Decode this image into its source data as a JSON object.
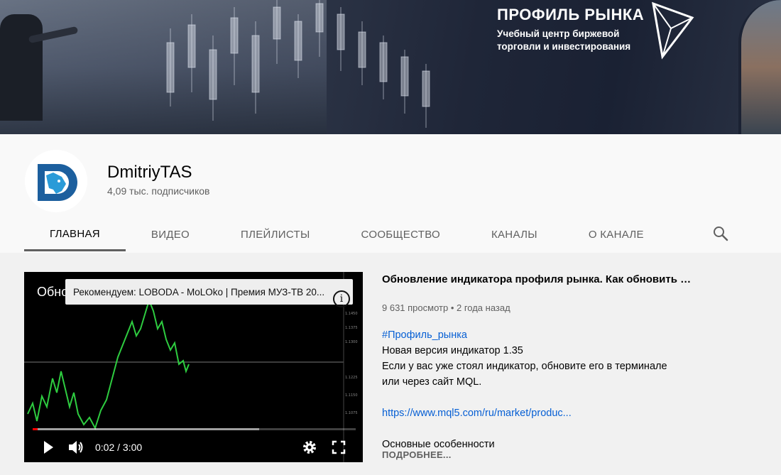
{
  "banner": {
    "brand_title": "ПРОФИЛЬ РЫНКА",
    "brand_line1": "Учебный центр биржевой",
    "brand_line2": "торговли и инвестирования"
  },
  "channel": {
    "name": "DmitriyTAS",
    "subscribers": "4,09 тыс. подписчиков"
  },
  "tabs": [
    {
      "label": "ГЛАВНАЯ",
      "active": true
    },
    {
      "label": "ВИДЕО",
      "active": false
    },
    {
      "label": "ПЛЕЙЛИСТЫ",
      "active": false
    },
    {
      "label": "СООБЩЕСТВО",
      "active": false
    },
    {
      "label": "КАНАЛЫ",
      "active": false
    },
    {
      "label": "О КАНАЛЕ",
      "active": false
    }
  ],
  "player": {
    "title_overlay": "Обно",
    "recommendation": "Рекомендуем: LOBODA - MoLOko | Премия МУЗ-ТВ 20...",
    "time": "0:02 / 3:00",
    "played_fraction": 0.015,
    "loaded_fraction": 0.7
  },
  "video": {
    "title": "Обновление индикатора профиля рынка. Как обновить …",
    "meta": "9 631 просмотр • 2 года назад",
    "hashtag": "#Профиль_рынка",
    "line1": "Новая версия индикатор 1.35",
    "line2": "Если у вас уже стоял индикатор, обновите его в терминале",
    "line3": "или через сайт MQL.",
    "link": "https://www.mql5.com/ru/market/produc...",
    "line4": "Основные особенности",
    "more_label": "ПОДРОБНЕЕ..."
  },
  "colors": {
    "accent_red": "#ff0000",
    "link_blue": "#065fd4",
    "avatar_blue": "#1c5f9e"
  }
}
